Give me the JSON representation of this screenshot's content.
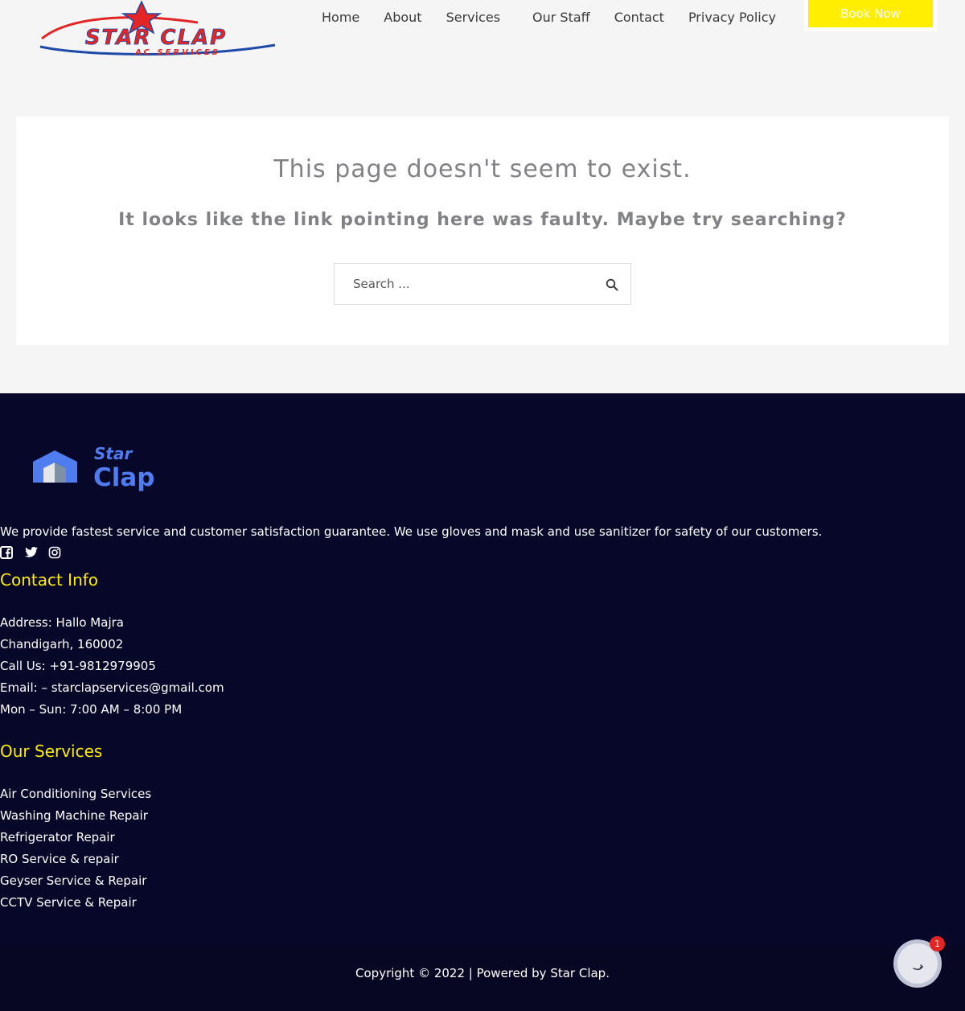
{
  "brand": {
    "logo_line1": "STAR CLAP",
    "logo_line2": "AC SERVICES",
    "footer_logo_word1": "Star",
    "footer_logo_word2": "Clap"
  },
  "nav": {
    "items": [
      {
        "label": "Home"
      },
      {
        "label": "About"
      },
      {
        "label": "Services"
      },
      {
        "label": "Our Staff"
      },
      {
        "label": "Contact"
      },
      {
        "label": "Privacy Policy"
      }
    ],
    "cta_label": "Book Now"
  },
  "notfound": {
    "title": "This page doesn't seem to exist.",
    "subtitle": "It looks like the link pointing here was faulty. Maybe try searching?",
    "search_placeholder": "Search ...",
    "search_icon": "search-icon"
  },
  "footer": {
    "tagline": "We provide fastest service and customer satisfaction guarantee. We use gloves and mask and use sanitizer for safety of our customers.",
    "social_icons": [
      "facebook-icon",
      "twitter-icon",
      "instagram-icon"
    ],
    "contact_heading": "Contact Info",
    "contact_lines": [
      "Address: Hallo Majra",
      "Chandigarh, 160002",
      "Call Us: +91-9812979905",
      "Email: – starclapservices@gmail.com",
      "Mon – Sun: 7:00 AM – 8:00 PM"
    ],
    "services_heading": "Our Services",
    "services": [
      "Air Conditioning Services",
      "Washing Machine Repair",
      "Refrigerator Repair",
      "RO Service & repair",
      "Geyser Service & Repair",
      "CCTV Service & Repair"
    ],
    "copyright": "Copyright © 2022 | Powered by Star Clap."
  },
  "chat": {
    "badge_count": "1",
    "icon": "chat-icon"
  },
  "colors": {
    "accent_yellow": "#ffee00",
    "footer_bg": "#07072a",
    "logo_red": "#e32525",
    "logo_blue": "#1e4aa8",
    "footer_logo_blue": "#4f7df0"
  }
}
